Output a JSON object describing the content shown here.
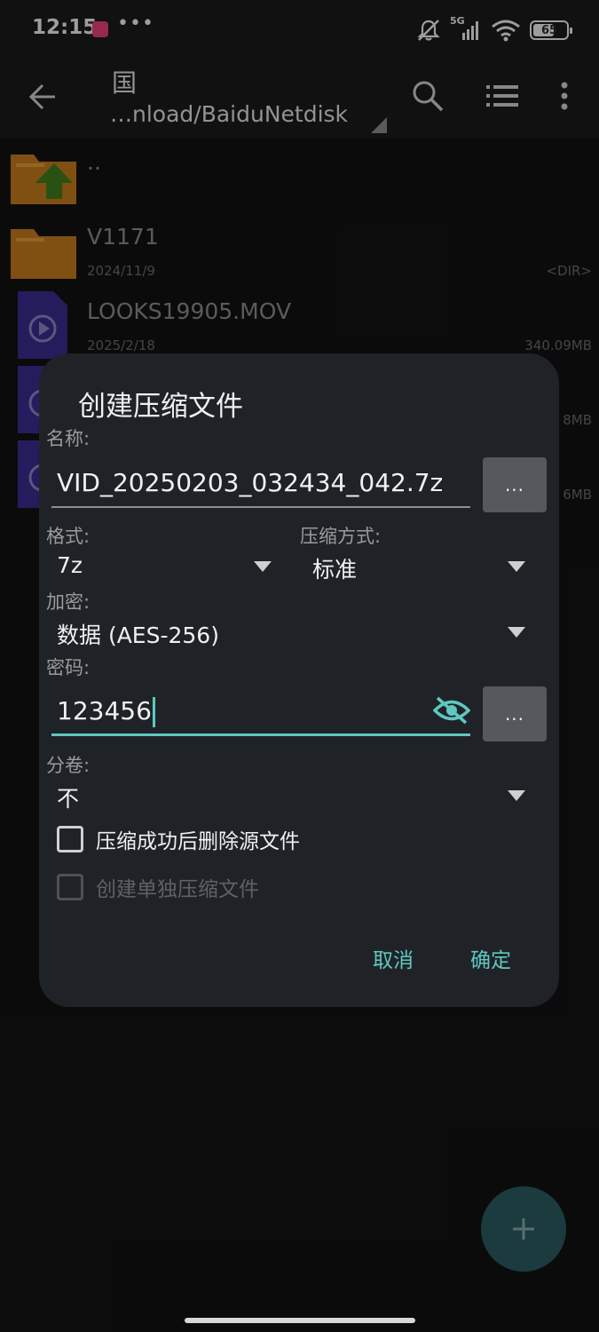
{
  "status_bar": {
    "time": "12:15",
    "more": "•••",
    "network": "5G",
    "battery": "65",
    "battery_level": 0.65,
    "icons": [
      "app-notification-icon",
      "mute-icon",
      "signal-icon",
      "wifi-icon",
      "battery-icon"
    ]
  },
  "app_bar": {
    "title": "国",
    "path": "…nload/BaiduNetdisk",
    "icons": [
      "back-arrow-icon",
      "dropdown-triangle-icon",
      "search-icon",
      "list-view-icon",
      "more-vert-icon"
    ]
  },
  "files": [
    {
      "name": "..",
      "date": "",
      "size": "",
      "icon": "folder-up-icon"
    },
    {
      "name": "V1171",
      "date": "2024/11/9",
      "size": "<DIR>",
      "icon": "folder-icon"
    },
    {
      "name": "LOOKS19905.MOV",
      "date": "2025/2/18",
      "size": "340.09MB",
      "icon": "video-file-icon"
    },
    {
      "name": "",
      "date": "",
      "size": "8MB",
      "icon": "video-file-icon"
    },
    {
      "name": "",
      "date": "",
      "size": "6MB",
      "icon": "video-file-icon"
    }
  ],
  "dialog": {
    "title": "创建压缩文件",
    "name_label": "名称:",
    "name_value": "VID_20250203_032434_042.7z",
    "browse_label": "...",
    "format_label": "格式:",
    "format_value": "7z",
    "method_label": "压缩方式:",
    "method_value": "标准",
    "encryption_label": "加密:",
    "encryption_value": "数据 (AES-256)",
    "password_label": "密码:",
    "password_value": "123456",
    "split_label": "分卷:",
    "split_value": "不",
    "delete_source_label": "压缩成功后删除源文件",
    "delete_source_checked": false,
    "separate_archives_label": "创建单独压缩文件",
    "separate_archives_enabled": false,
    "cancel_label": "取消",
    "ok_label": "确定"
  },
  "fab": {
    "label": "+"
  },
  "colors": {
    "accent": "#5fc8c0",
    "dialog_bg": "#1f2328",
    "folder": "#c57a1c",
    "folder_arrow": "#3f7d1e",
    "video_file": "#3a2c8f"
  }
}
